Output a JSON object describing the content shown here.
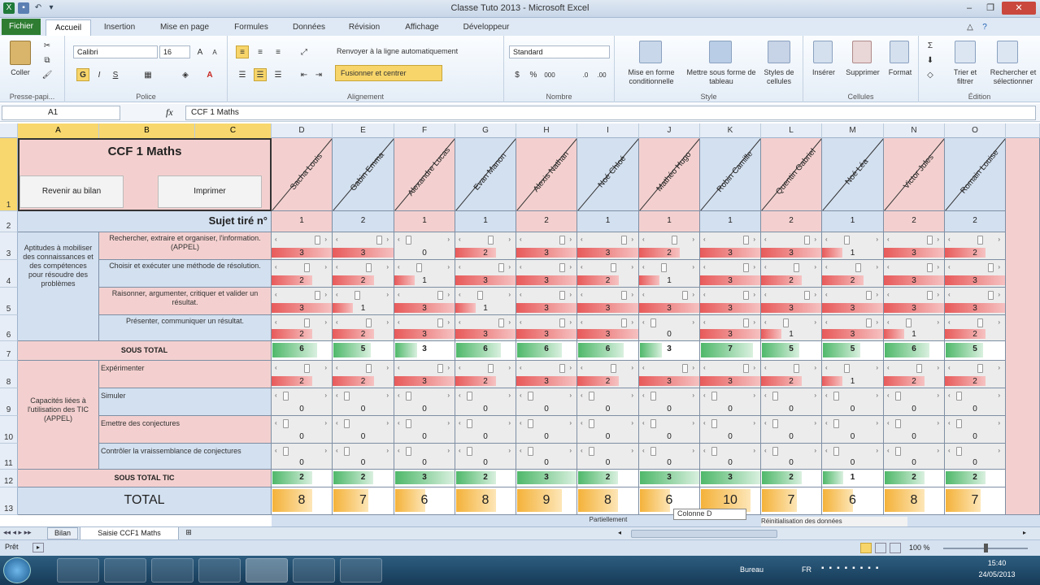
{
  "window": {
    "title": "Classe Tuto 2013 - Microsoft Excel"
  },
  "tabs": [
    {
      "label": "Fichier"
    },
    {
      "label": "Accueil"
    },
    {
      "label": "Insertion"
    },
    {
      "label": "Mise en page"
    },
    {
      "label": "Formules"
    },
    {
      "label": "Données"
    },
    {
      "label": "Révision"
    },
    {
      "label": "Affichage"
    },
    {
      "label": "Développeur"
    }
  ],
  "ribbon": {
    "paste": "Coller",
    "clipboard": "Presse-papi...",
    "font_name": "Calibri",
    "font_size": "16",
    "police": "Police",
    "wrap": "Renvoyer à la ligne automatiquement",
    "merge": "Fusionner et centrer",
    "alignement": "Alignement",
    "number_format": "Standard",
    "nombre": "Nombre",
    "cond": "Mise en forme conditionnelle",
    "table": "Mettre sous forme de tableau",
    "cellstyles": "Styles de cellules",
    "style": "Style",
    "insert": "Insérer",
    "delete": "Supprimer",
    "format": "Format",
    "cellules": "Cellules",
    "sort": "Trier et filtrer",
    "find": "Rechercher et sélectionner",
    "edition": "Édition"
  },
  "formula": {
    "namebox": "A1",
    "fx": "fx",
    "content": "CCF 1 Maths"
  },
  "columns": [
    "A",
    "B",
    "C",
    "D",
    "E",
    "F",
    "G",
    "H",
    "I",
    "J",
    "K",
    "L",
    "M",
    "N",
    "O"
  ],
  "rows": [
    "1",
    "2",
    "3",
    "4",
    "5",
    "6",
    "7",
    "8",
    "9",
    "10",
    "11",
    "12",
    "13"
  ],
  "sheet": {
    "title": "CCF 1 Maths",
    "btn_bilan": "Revenir au bilan",
    "btn_print": "Imprimer",
    "subject_label": "Sujet tiré n°",
    "group1": "Aptitudes à mobiliser des connaissances et des compétences pour résoudre des problèmes",
    "crit": [
      "Rechercher, extraire et organiser, l'information. (APPEL)",
      "Choisir et exécuter une méthode de résolution.",
      "Raisonner, argumenter, critiquer et valider un résultat.",
      "Présenter, communiquer un résultat."
    ],
    "sous_total": "SOUS TOTAL",
    "group2": "Capacités liées à l'utilisation des TIC (APPEL)",
    "tic": [
      "Expérimenter",
      "Simuler",
      "Emettre des conjectures",
      "Contrôler la vraissemblance de conjectures"
    ],
    "sous_total_tic": "SOUS TOTAL TIC",
    "total": "TOTAL",
    "bottom_partial": "Partiellement",
    "tooltip": "Colonne D",
    "bottom_right": "Réinitialisation des données"
  },
  "students": [
    {
      "name": "Sacha Louis",
      "sujet": "1",
      "c": [
        3,
        2,
        3,
        2
      ],
      "st": 6,
      "t": [
        2,
        0,
        0,
        0
      ],
      "tic": 2,
      "total": 8
    },
    {
      "name": "Gabin Emma",
      "sujet": "2",
      "c": [
        3,
        2,
        1,
        2
      ],
      "st": 5,
      "t": [
        2,
        0,
        0,
        0
      ],
      "tic": 2,
      "total": 7
    },
    {
      "name": "Alexandre Lucas",
      "sujet": "1",
      "c": [
        0,
        1,
        3,
        3
      ],
      "st": 3,
      "t": [
        3,
        0,
        0,
        0
      ],
      "tic": 3,
      "total": 6
    },
    {
      "name": "Evan Manon",
      "sujet": "1",
      "c": [
        2,
        3,
        1,
        3
      ],
      "st": 6,
      "t": [
        2,
        0,
        0,
        0
      ],
      "tic": 2,
      "total": 8
    },
    {
      "name": "Alexis Nathan",
      "sujet": "2",
      "c": [
        3,
        3,
        3,
        3
      ],
      "st": 6,
      "t": [
        3,
        0,
        0,
        0
      ],
      "tic": 3,
      "total": 9
    },
    {
      "name": "Noé Chloé",
      "sujet": "1",
      "c": [
        3,
        2,
        3,
        3
      ],
      "st": 6,
      "t": [
        2,
        0,
        0,
        0
      ],
      "tic": 2,
      "total": 8
    },
    {
      "name": "Mathéo Hugo",
      "sujet": "1",
      "c": [
        2,
        1,
        3,
        0
      ],
      "st": 3,
      "t": [
        3,
        0,
        0,
        0
      ],
      "tic": 3,
      "total": 6
    },
    {
      "name": "Robin Camille",
      "sujet": "1",
      "c": [
        3,
        3,
        3,
        3
      ],
      "st": 7,
      "t": [
        3,
        0,
        0,
        0
      ],
      "tic": 3,
      "total": 10
    },
    {
      "name": "Quentin Gabriel",
      "sujet": "2",
      "c": [
        3,
        2,
        3,
        1
      ],
      "st": 5,
      "t": [
        2,
        0,
        0,
        0
      ],
      "tic": 2,
      "total": 7
    },
    {
      "name": "Noé Léa",
      "sujet": "1",
      "c": [
        1,
        2,
        3,
        3
      ],
      "st": 5,
      "t": [
        1,
        0,
        0,
        0
      ],
      "tic": 1,
      "total": 6
    },
    {
      "name": "Victor Jules",
      "sujet": "2",
      "c": [
        3,
        3,
        3,
        1
      ],
      "st": 6,
      "t": [
        2,
        0,
        0,
        0
      ],
      "tic": 2,
      "total": 8
    },
    {
      "name": "Romain Louise",
      "sujet": "2",
      "c": [
        2,
        3,
        3,
        2
      ],
      "st": 5,
      "t": [
        2,
        0,
        0,
        0
      ],
      "tic": 2,
      "total": 7
    }
  ],
  "sheet_tabs": [
    {
      "label": "Bilan"
    },
    {
      "label": "Saisie CCF1 Maths"
    }
  ],
  "status": {
    "ready": "Prêt",
    "zoom": "100 %"
  },
  "taskbar": {
    "desktop": "Bureau",
    "lang": "FR",
    "time": "15:40",
    "date": "24/05/2013"
  },
  "colors": {
    "pink": "#f3d0cf",
    "blue": "#d3e0f0",
    "red_bar": "#e85a5a",
    "green_bar": "#4fb86a",
    "orange_bar": "#f4b23a",
    "selected_header": "#f8d86e"
  }
}
